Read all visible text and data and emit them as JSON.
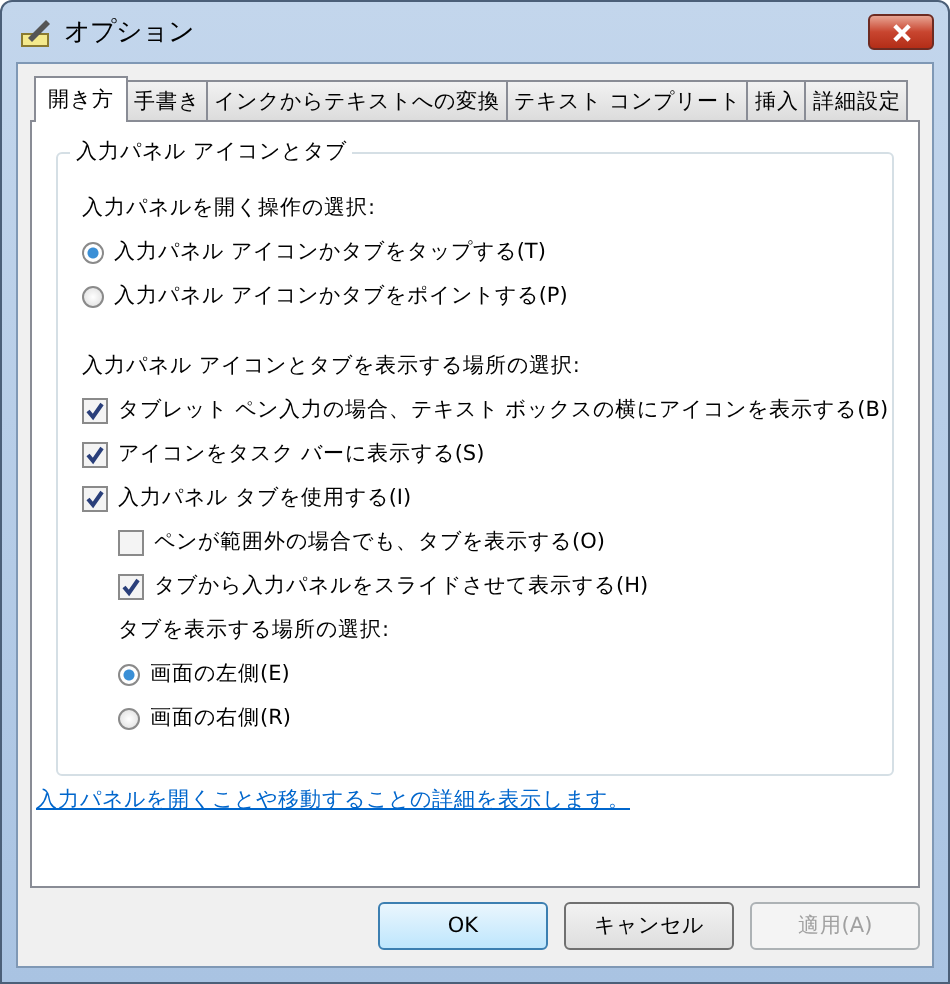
{
  "window": {
    "title": "オプション"
  },
  "tabs": [
    {
      "label": "開き方",
      "selected": true
    },
    {
      "label": "手書き",
      "selected": false
    },
    {
      "label": "インクからテキストへの変換",
      "selected": false
    },
    {
      "label": "テキスト コンプリート",
      "selected": false
    },
    {
      "label": "挿入",
      "selected": false
    },
    {
      "label": "詳細設定",
      "selected": false
    }
  ],
  "group": {
    "title": "入力パネル アイコンとタブ",
    "items": [
      {
        "kind": "heading",
        "label": "入力パネルを開く操作の選択:"
      },
      {
        "kind": "radio",
        "label": "入力パネル アイコンかタブをタップする(T)",
        "selected": true
      },
      {
        "kind": "radio",
        "label": "入力パネル アイコンかタブをポイントする(P)",
        "selected": false
      },
      {
        "kind": "heading",
        "label": "入力パネル アイコンとタブを表示する場所の選択:"
      },
      {
        "kind": "checkbox",
        "label": "タブレット ペン入力の場合、テキスト ボックスの横にアイコンを表示する(B)",
        "checked": true
      },
      {
        "kind": "checkbox",
        "label": "アイコンをタスク バーに表示する(S)",
        "checked": true
      },
      {
        "kind": "checkbox",
        "label": "入力パネル タブを使用する(I)",
        "checked": true,
        "children": [
          {
            "kind": "checkbox",
            "label": "ペンが範囲外の場合でも、タブを表示する(O)",
            "checked": false
          },
          {
            "kind": "checkbox",
            "label": "タブから入力パネルをスライドさせて表示する(H)",
            "checked": true
          },
          {
            "kind": "heading",
            "label": "タブを表示する場所の選択:"
          },
          {
            "kind": "radio",
            "label": "画面の左側(E)",
            "selected": true
          },
          {
            "kind": "radio",
            "label": "画面の右側(R)",
            "selected": false
          }
        ]
      }
    ]
  },
  "link": "入力パネルを開くことや移動することの詳細を表示します。",
  "buttons": [
    {
      "label": "OK",
      "kind": "default",
      "disabled": false
    },
    {
      "label": "キャンセル",
      "kind": "normal",
      "disabled": false
    },
    {
      "label": "適用(A)",
      "kind": "normal",
      "disabled": true
    }
  ]
}
